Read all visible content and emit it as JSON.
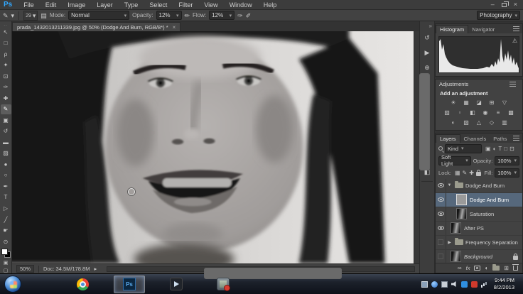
{
  "colors": {
    "ps_blue": "#31a8ff",
    "layer_selection": "#56687c",
    "panel_bg": "#424242",
    "app_bg": "#333333"
  },
  "icons": {
    "dropdown": "▾",
    "spinner": "▾",
    "close": "×",
    "minimize": "–",
    "warning": "⚠",
    "collapse_dock": "»",
    "panel_collapse": "«",
    "caret_expanded": "▼",
    "caret_collapsed": "▶",
    "status_arrow": "▸",
    "grip": "..",
    "brush_tool_glyph": "✎",
    "toggle_brush_panel": "▤",
    "pressure_opacity": "✏",
    "airbrush": "✑",
    "pressure_size": "✐"
  },
  "menubar": {
    "logo": "Ps",
    "items": [
      "File",
      "Edit",
      "Image",
      "Layer",
      "Type",
      "Select",
      "Filter",
      "View",
      "Window",
      "Help"
    ]
  },
  "options": {
    "brush_size": "29",
    "mode_label": "Mode:",
    "mode_value": "Normal",
    "opacity_label": "Opacity:",
    "opacity_value": "12%",
    "flow_label": "Flow:",
    "flow_value": "12%",
    "workspace": "Photography"
  },
  "document_tab": {
    "title": "prada_1432013211339.jpg @ 50% (Dodge And Burn, RGB/8*) *"
  },
  "tools": [
    {
      "name": "move-tool",
      "glyph": "↖"
    },
    {
      "name": "marquee-tool",
      "glyph": "□"
    },
    {
      "name": "lasso-tool",
      "glyph": "ρ"
    },
    {
      "name": "quick-selection-tool",
      "glyph": "✦"
    },
    {
      "name": "crop-tool",
      "glyph": "⊡"
    },
    {
      "name": "eyedropper-tool",
      "glyph": "✑"
    },
    {
      "name": "spot-healing-brush-tool",
      "glyph": "✚"
    },
    {
      "name": "brush-tool",
      "glyph": "✎",
      "selected": true
    },
    {
      "name": "clone-stamp-tool",
      "glyph": "▣"
    },
    {
      "name": "history-brush-tool",
      "glyph": "↺"
    },
    {
      "name": "eraser-tool",
      "glyph": "▬"
    },
    {
      "name": "gradient-tool",
      "glyph": "▨"
    },
    {
      "name": "blur-tool",
      "glyph": "●"
    },
    {
      "name": "dodge-tool",
      "glyph": "○"
    },
    {
      "name": "pen-tool",
      "glyph": "✒"
    },
    {
      "name": "type-tool",
      "glyph": "T"
    },
    {
      "name": "path-selection-tool",
      "glyph": "▷"
    },
    {
      "name": "line-tool",
      "glyph": "╱"
    },
    {
      "name": "hand-tool",
      "glyph": "☛"
    },
    {
      "name": "zoom-tool",
      "glyph": "⊙"
    }
  ],
  "dock_icons": [
    {
      "name": "history-panel-icon",
      "glyph": "↺"
    },
    {
      "name": "actions-panel-icon",
      "glyph": "▶"
    },
    {
      "name": "clone-source-panel-icon",
      "glyph": "⊕"
    },
    {
      "name": "info-panel-icon",
      "glyph": "i"
    },
    {
      "name": "brush-panel-icon",
      "glyph": "✎"
    },
    {
      "name": "brush-presets-panel-icon",
      "glyph": "✐"
    },
    {
      "name": "layer-comps-panel-icon",
      "glyph": "▤"
    },
    {
      "name": "character-panel-icon",
      "glyph": "A"
    },
    {
      "name": "paragraph-panel-icon",
      "glyph": "¶"
    },
    {
      "name": "properties-panel-icon",
      "glyph": "◧"
    }
  ],
  "panels": {
    "histogram": {
      "tabs": [
        "Histogram",
        "Navigator"
      ],
      "active_tab": "Histogram"
    },
    "adjustments": {
      "title": "Adjustments",
      "subtitle": "Add an adjustment",
      "rows": [
        [
          {
            "name": "brightness-contrast-adjustment-icon",
            "glyph": "☀"
          },
          {
            "name": "levels-adjustment-icon",
            "glyph": "▦"
          },
          {
            "name": "curves-adjustment-icon",
            "glyph": "◪"
          },
          {
            "name": "exposure-adjustment-icon",
            "glyph": "⊞"
          },
          {
            "name": "vibrance-adjustment-icon",
            "glyph": "▽"
          }
        ],
        [
          {
            "name": "hue-saturation-adjustment-icon",
            "glyph": "▨"
          },
          {
            "name": "color-balance-adjustment-icon",
            "glyph": "▫"
          },
          {
            "name": "black-white-adjustment-icon",
            "glyph": "◧"
          },
          {
            "name": "photo-filter-adjustment-icon",
            "glyph": "◉"
          },
          {
            "name": "channel-mixer-adjustment-icon",
            "glyph": "≡"
          },
          {
            "name": "color-lookup-adjustment-icon",
            "glyph": "▩"
          }
        ],
        [
          {
            "name": "invert-adjustment-icon",
            "glyph": "◐"
          },
          {
            "name": "posterize-adjustment-icon",
            "glyph": "▧"
          },
          {
            "name": "threshold-adjustment-icon",
            "glyph": "△"
          },
          {
            "name": "selective-color-adjustment-icon",
            "glyph": "◇"
          },
          {
            "name": "gradient-map-adjustment-icon",
            "glyph": "▥"
          }
        ]
      ]
    },
    "layers": {
      "tabs": [
        "Layers",
        "Channels",
        "Paths"
      ],
      "filter_label": "Kind",
      "filter_icons": [
        {
          "name": "filter-pixel-layers-icon",
          "glyph": "▣"
        },
        {
          "name": "filter-adjustment-layers-icon",
          "glyph": "◐"
        },
        {
          "name": "filter-type-layers-icon",
          "glyph": "T"
        },
        {
          "name": "filter-shape-layers-icon",
          "glyph": "□"
        },
        {
          "name": "filter-smart-objects-icon",
          "glyph": "⊡"
        }
      ],
      "blend_mode": "Soft Light",
      "opacity_label": "Opacity:",
      "opacity_value": "100%",
      "lock_label": "Lock:",
      "lock_icons": [
        {
          "name": "lock-transparency-icon",
          "glyph": "▦"
        },
        {
          "name": "lock-pixels-icon",
          "glyph": "✎"
        },
        {
          "name": "lock-position-icon",
          "glyph": "✚"
        }
      ],
      "fill_label": "Fill:",
      "fill_value": "100%",
      "items": [
        {
          "name": "Dodge And Burn"
        },
        {
          "name": "Dodge And Burn"
        },
        {
          "name": "Saturation"
        },
        {
          "name": "After PS"
        },
        {
          "name": "Frequency Separation"
        },
        {
          "name": "Background"
        }
      ],
      "bottom_icons": {
        "link": "∞",
        "fx": "fx",
        "adjustment": "◐",
        "new_layer": "⊞"
      }
    }
  },
  "statusbar": {
    "zoom": "50%",
    "doc": "Doc: 34.5M/178.8M"
  },
  "taskbar": {
    "clock_time": "9:44 PM",
    "clock_date": "8/2/2013",
    "ps_label": "Ps"
  }
}
